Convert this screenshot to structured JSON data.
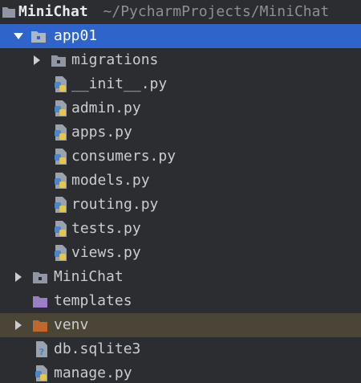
{
  "project": {
    "name": "MiniChat",
    "path": "~/PycharmProjects/MiniChat",
    "items": [
      {
        "label": "app01",
        "icon": "folder-icon",
        "state": "expanded",
        "selected": true
      },
      {
        "label": "migrations",
        "icon": "folder-icon",
        "state": "collapsed"
      },
      {
        "label": "__init__.py",
        "icon": "python-file-icon"
      },
      {
        "label": "admin.py",
        "icon": "python-file-icon"
      },
      {
        "label": "apps.py",
        "icon": "python-file-icon"
      },
      {
        "label": "consumers.py",
        "icon": "python-file-icon"
      },
      {
        "label": "models.py",
        "icon": "python-file-icon"
      },
      {
        "label": "routing.py",
        "icon": "python-file-icon"
      },
      {
        "label": "tests.py",
        "icon": "python-file-icon"
      },
      {
        "label": "views.py",
        "icon": "python-file-icon"
      },
      {
        "label": "MiniChat",
        "icon": "folder-icon",
        "state": "collapsed"
      },
      {
        "label": "templates",
        "icon": "templates-folder-icon"
      },
      {
        "label": "venv",
        "icon": "excluded-folder-icon",
        "state": "collapsed",
        "excluded": true
      },
      {
        "label": "db.sqlite3",
        "icon": "unknown-file-icon"
      },
      {
        "label": "manage.py",
        "icon": "python-file-icon"
      }
    ]
  },
  "colors": {
    "background": "#2b2d30",
    "selection": "#2f65ca",
    "excluded_row": "#4a4537",
    "folder": "#8e97a3",
    "templates_folder": "#9b7fc6",
    "excluded_folder": "#c1672e",
    "python_blue": "#4a86c8",
    "python_yellow": "#e8c44a"
  }
}
